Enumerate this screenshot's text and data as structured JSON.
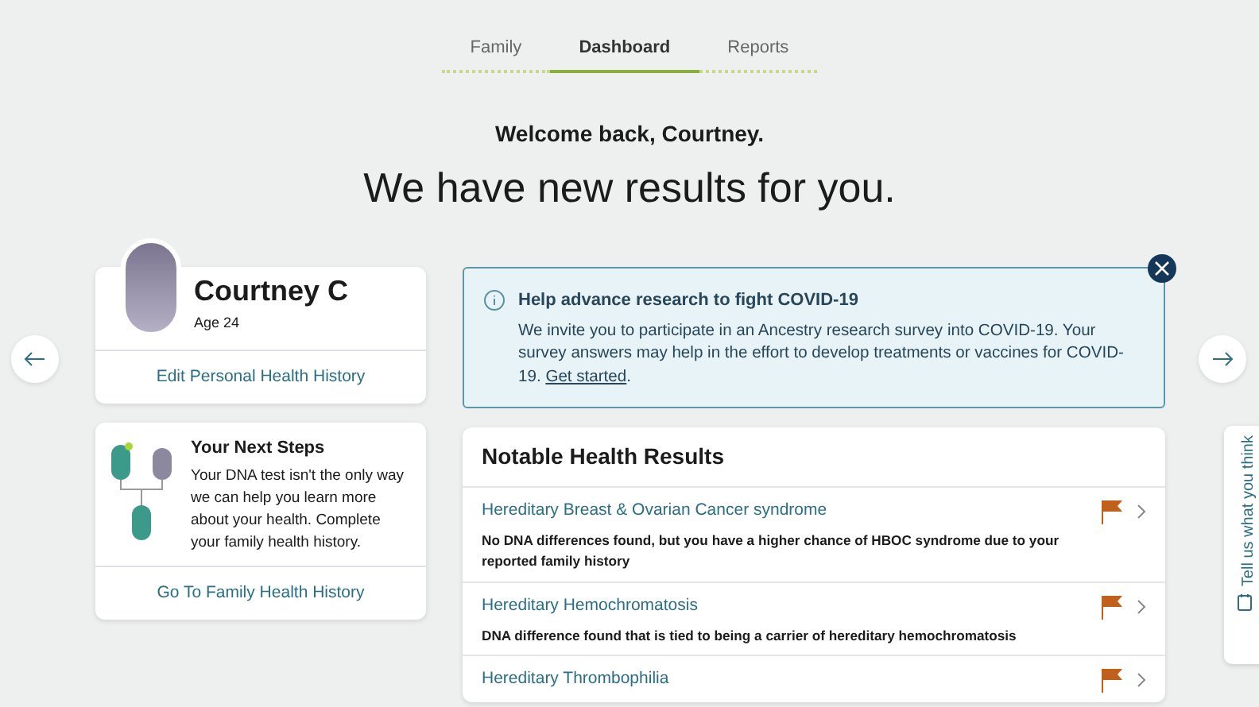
{
  "tabs": [
    {
      "label": "Family",
      "selected": false
    },
    {
      "label": "Dashboard",
      "selected": true
    },
    {
      "label": "Reports",
      "selected": false
    }
  ],
  "welcome": "Welcome back, Courtney.",
  "headline": "We have new results for you.",
  "profile": {
    "name": "Courtney C",
    "age": "Age 24",
    "link": "Edit Personal Health History"
  },
  "next_steps": {
    "title": "Your Next Steps",
    "body": "Your DNA test isn't the only way we can help you learn more about your health. Complete your family health history.",
    "link": "Go To Family Health History"
  },
  "alert": {
    "title": "Help advance research to fight COVID-19",
    "body": "We invite you to participate in an Ancestry research survey into COVID-19. Your survey answers may help in the effort to develop treatments or vaccines for COVID-19.",
    "link": "Get started",
    "after": "."
  },
  "results": {
    "title": "Notable Health Results",
    "items": [
      {
        "name": "Hereditary Breast & Ovarian Cancer syndrome",
        "detail": "No DNA differences found, but you have a higher chance of HBOC syndrome due to your reported family history",
        "flagged": true
      },
      {
        "name": "Hereditary Hemochromatosis",
        "detail": "DNA difference found that is tied to being a carrier of hereditary hemochromatosis",
        "flagged": true
      },
      {
        "name": "Hereditary Thrombophilia",
        "flagged": true
      }
    ]
  },
  "feedback": "Tell us what you think"
}
